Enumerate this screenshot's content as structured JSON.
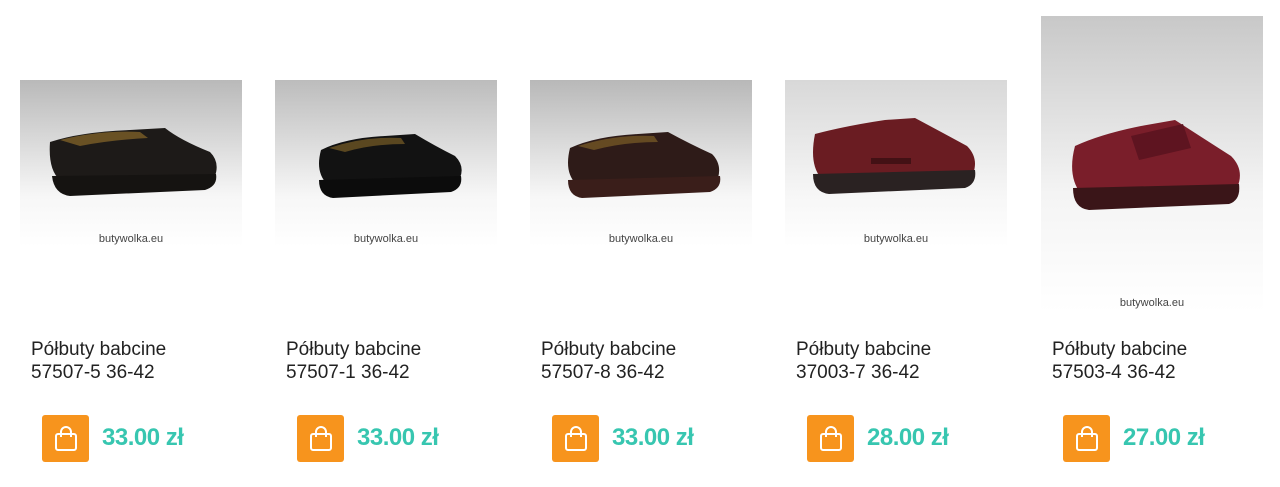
{
  "currency": "zł",
  "products": [
    {
      "name_line1": "Półbuty babcine",
      "name_line2": "57507-5 36-42",
      "price": "33.00 zł",
      "watermark": "butywolka.eu",
      "shoe_color": "#1d1a18",
      "sole_color": "#151311",
      "bg_top": "#b9b9b9",
      "bg_bottom": "#f7f7f7"
    },
    {
      "name_line1": "Półbuty babcine",
      "name_line2": "57507-1 36-42",
      "price": "33.00 zł",
      "watermark": "butywolka.eu",
      "shoe_color": "#121212",
      "sole_color": "#0c0c0c",
      "bg_top": "#bcbcbc",
      "bg_bottom": "#f7f7f7"
    },
    {
      "name_line1": "Półbuty babcine",
      "name_line2": "57507-8 36-42",
      "price": "33.00 zł",
      "watermark": "butywolka.eu",
      "shoe_color": "#2e1b18",
      "sole_color": "#3a1e1a",
      "bg_top": "#b8b8b8",
      "bg_bottom": "#f7f7f7"
    },
    {
      "name_line1": "Półbuty babcine",
      "name_line2": "37003-7 36-42",
      "price": "28.00 zł",
      "watermark": "butywolka.eu",
      "shoe_color": "#6a1c22",
      "sole_color": "#2a2222",
      "bg_top": "#d8d8d8",
      "bg_bottom": "#f7f7f7"
    },
    {
      "name_line1": "Półbuty babcine",
      "name_line2": "57503-4 36-42",
      "price": "27.00 zł",
      "watermark": "butywolka.eu",
      "shoe_color": "#7a1e2a",
      "sole_color": "#3a1518",
      "bg_top": "#c8c8c8",
      "bg_bottom": "#f4f4f4"
    }
  ],
  "colors": {
    "accent_orange": "#f7941d",
    "price_teal": "#37c6b0",
    "title_text": "#222222"
  },
  "icons": {
    "cart_button": "shopping-bag-icon"
  }
}
